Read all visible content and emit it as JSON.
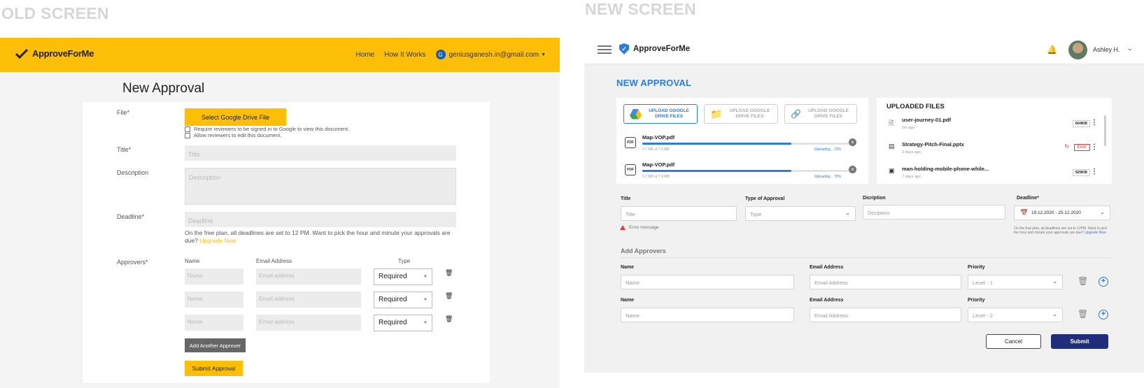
{
  "captions": {
    "old": "OLD SCREEN",
    "new": "NEW SCREEN"
  },
  "old": {
    "brand": "ApproveForMe",
    "nav": {
      "home": "Home",
      "how": "How It Works",
      "avatar_letter": "G",
      "email": "geniusganesh.in@gmail.com"
    },
    "page_title": "New Approval",
    "labels": {
      "file": "File*",
      "title": "Title*",
      "description": "Description",
      "deadline": "Deadline*",
      "approvers": "Approvers*"
    },
    "select_drive_button": "Select Google Drive File",
    "checkboxes": [
      "Require reviewers to be signed in to Google to view this document.",
      "Allow reviewers to edit this document."
    ],
    "placeholders": {
      "title": "Title",
      "description": "Description",
      "deadline": "Deadline",
      "name": "Name",
      "email": "Email address"
    },
    "deadline_note": "On the free plan, all deadlines are set to 12 PM. Want to pick the hour and minute your approvals are due?",
    "upgrade_link": "Upgrade Now",
    "columns": {
      "name": "Name",
      "email": "Email Address",
      "type": "Type"
    },
    "approver_type": "Required",
    "add_button": "Add Another Approver",
    "submit_button": "Submit Approval"
  },
  "new": {
    "brand": "ApproveForMe",
    "user_name": "Ashley H.",
    "page_title": "NEW APPROVAL",
    "upload_buttons": [
      "UPLOAD GOOGLE DRIVE FILES",
      "UPLOAD GOOGLE DRIVE FILES",
      "UPLOAD GOOGLE DRIVE FILES"
    ],
    "uploads": [
      {
        "icon": "PDF",
        "name": "Map-VOP.pdf",
        "size": "5.7 MB of 7.3 MB",
        "status": "Uploading... 72%",
        "progress": 0.72
      },
      {
        "icon": "PDF",
        "name": "Map-VOP.pdf",
        "size": "5.7 MB of 7.3 MB",
        "status": "Uploading... 72%",
        "progress": 0.72
      }
    ],
    "uploaded_title": "UPLOADED FILES",
    "files": [
      {
        "name": "user-journey-01.pdf",
        "age": "2m ago",
        "size": "604KB"
      },
      {
        "name": "Strategy-Pitch-Final.pptx",
        "age": "3 days ago",
        "size": "Error"
      },
      {
        "name": "man-holding-mobile-phone-while...",
        "age": "7 days ago",
        "size": "929KB"
      }
    ],
    "labels": {
      "title": "Title",
      "type": "Type of Approval",
      "description": "Dicription",
      "deadline": "Deadline*"
    },
    "placeholders": {
      "title": "Title",
      "type": "Type",
      "description": "Dicription",
      "name": "Name",
      "email": "Email Address"
    },
    "deadline_value": "19.12.2020 - 25.12.2020",
    "error_message": "Error message",
    "deadline_note": "On the free plan, all deadlines are set to 12PM. Want to pick the hour and minute your approvals are due?",
    "upgrade_link": "Upgrade Now",
    "add_approvers": "Add Approvers",
    "approver_labels": {
      "name": "Name",
      "email": "Email Address",
      "priority": "Priority"
    },
    "priorities": [
      "Level - 1",
      "Level - 2"
    ],
    "cancel": "Cancel",
    "submit": "Submit"
  }
}
